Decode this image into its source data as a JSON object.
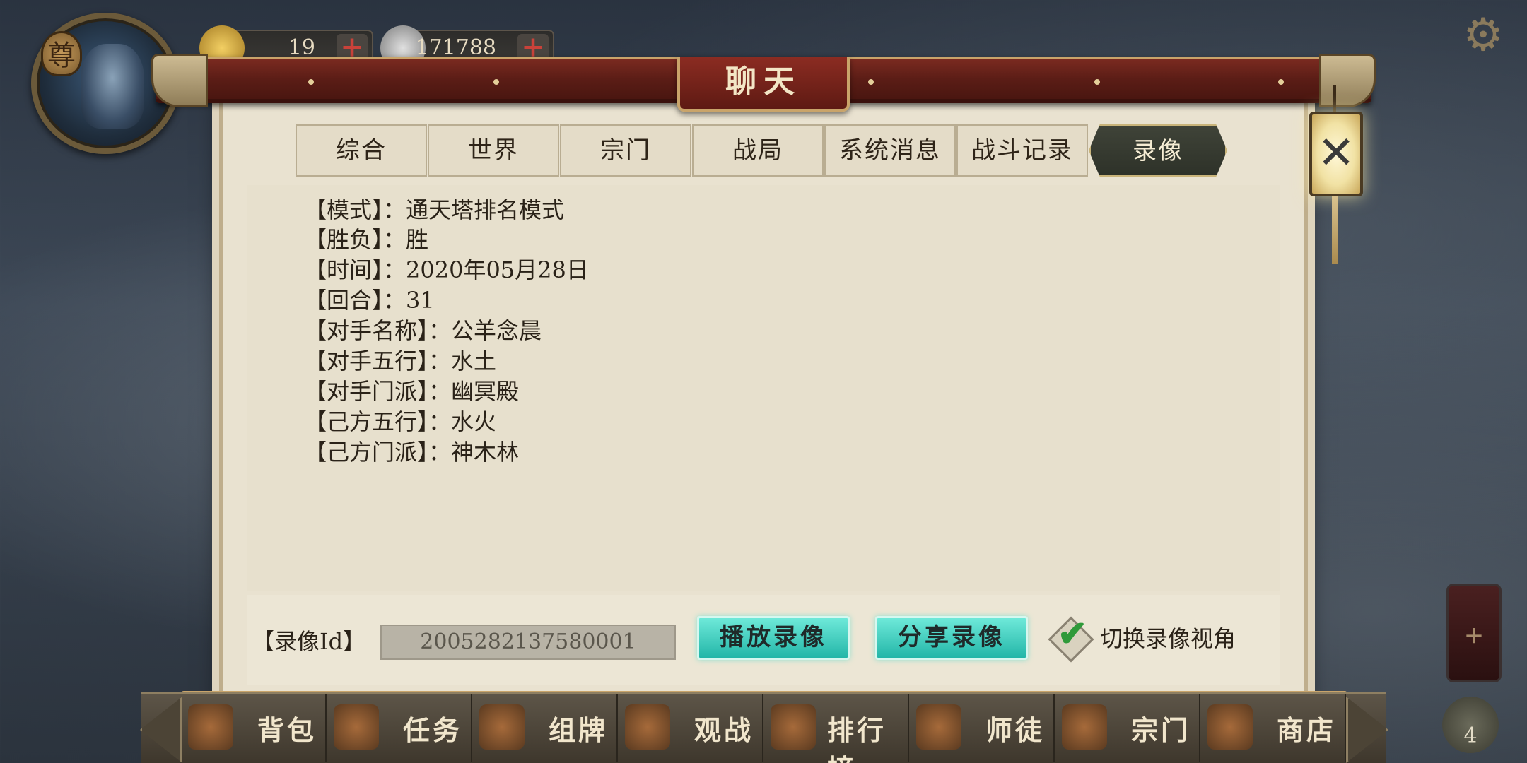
{
  "hud": {
    "rank_char": "尊",
    "gold_value": "19",
    "silver_value": "171788",
    "plus": "+"
  },
  "dialog": {
    "title": "聊天",
    "tabs": [
      {
        "label": "综合"
      },
      {
        "label": "世界"
      },
      {
        "label": "宗门"
      },
      {
        "label": "战局"
      },
      {
        "label": "系统消息"
      },
      {
        "label": "战斗记录"
      },
      {
        "label": "录像",
        "active": true
      }
    ],
    "info": [
      {
        "line": "【模式】：通天塔排名模式"
      },
      {
        "line": "【胜负】：胜"
      },
      {
        "line": "【时间】：2020年05月28日"
      },
      {
        "line": "【回合】：31"
      },
      {
        "line": "【对手名称】：公羊念晨"
      },
      {
        "line": "【对手五行】：水土"
      },
      {
        "line": "【对手门派】：幽冥殿"
      },
      {
        "line": "【己方五行】：水火"
      },
      {
        "line": "【己方门派】：神木林"
      }
    ],
    "replay_id_label": "【录像Id】",
    "replay_id_value": "2005282137580001",
    "play_button": "播放录像",
    "share_button": "分享录像",
    "switch_view_label": "切换录像视角",
    "switch_view_checked": true,
    "close_symbol": "✕"
  },
  "side": {
    "potion_plus": "+",
    "bag_count": "4"
  },
  "bottom_nav": [
    {
      "label": "背包"
    },
    {
      "label": "任务"
    },
    {
      "label": "组牌"
    },
    {
      "label": "观战"
    },
    {
      "label": "排行榜"
    },
    {
      "label": "师徒"
    },
    {
      "label": "宗门"
    },
    {
      "label": "商店"
    }
  ],
  "colors": {
    "active_tab_bg": "#2e3229",
    "teal_button": "#23b6a8",
    "paper": "#e9e2d0",
    "banner": "#5b1d16"
  }
}
